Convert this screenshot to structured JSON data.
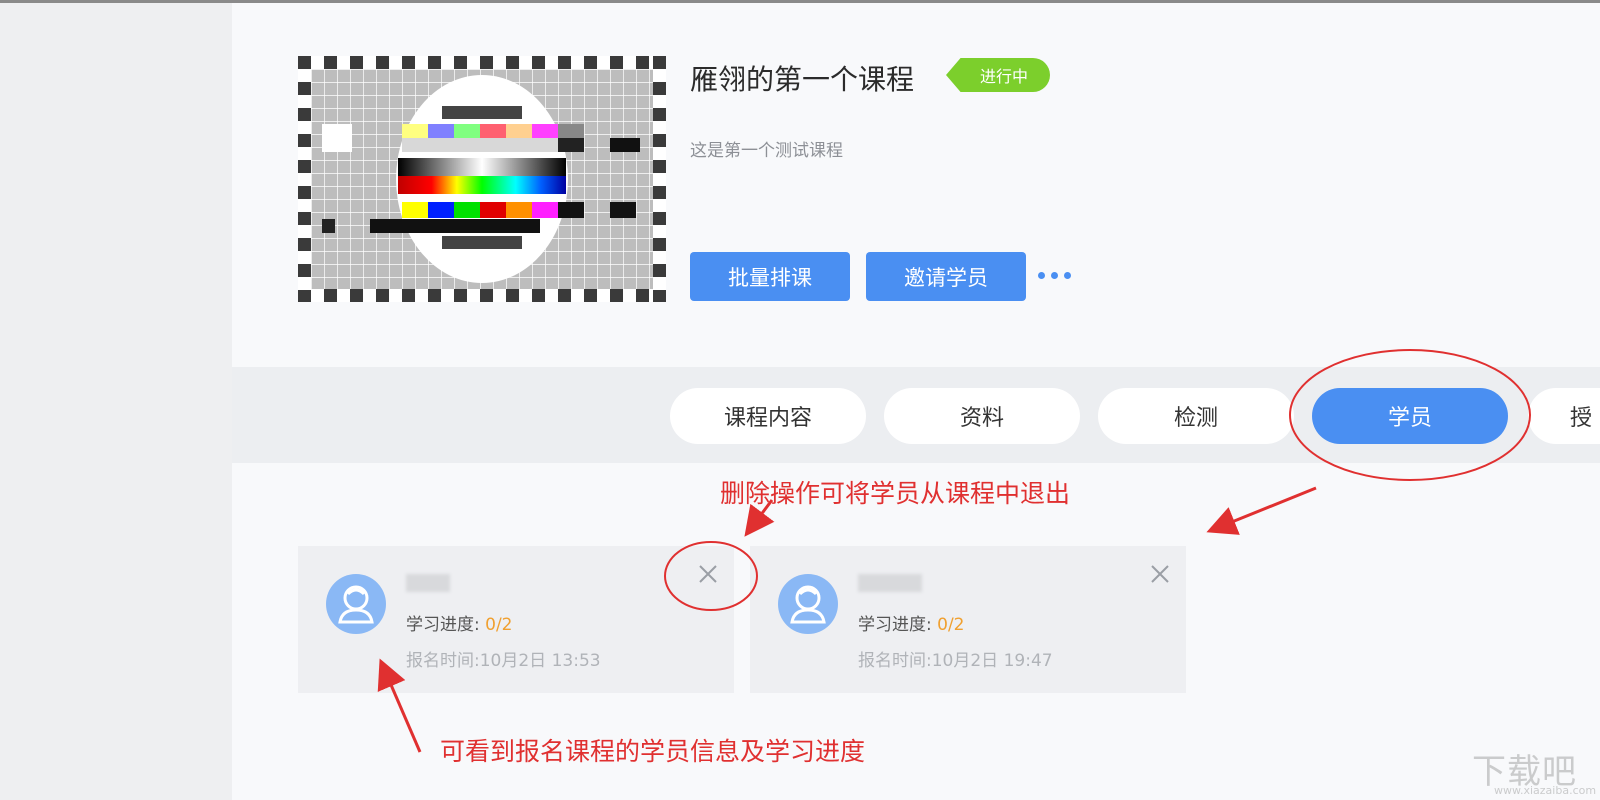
{
  "course": {
    "title": "雁翎的第一个课程",
    "status": "进行中",
    "description": "这是第一个测试课程"
  },
  "actions": {
    "schedule_label": "批量排课",
    "invite_label": "邀请学员"
  },
  "tabs": [
    {
      "label": "课程内容"
    },
    {
      "label": "资料"
    },
    {
      "label": "检测"
    },
    {
      "label": "学员"
    },
    {
      "label": "授"
    }
  ],
  "active_tab": "学员",
  "students": [
    {
      "progress_label": "学习进度: ",
      "progress_value": "0/2",
      "enroll_time": "报名时间:10月2日 13:53"
    },
    {
      "progress_label": "学习进度: ",
      "progress_value": "0/2",
      "enroll_time": "报名时间:10月2日 19:47"
    }
  ],
  "annotations": {
    "delete_note": "删除操作可将学员从课程中退出",
    "info_note": "可看到报名课程的学员信息及学习进度"
  },
  "watermark": {
    "text": "下载吧",
    "url": "www.xiazaiba.com"
  },
  "colors": {
    "accent": "#4a8ff2",
    "status_badge": "#7ccf2c",
    "progress_value": "#f0a030",
    "annotation": "#e03030"
  }
}
